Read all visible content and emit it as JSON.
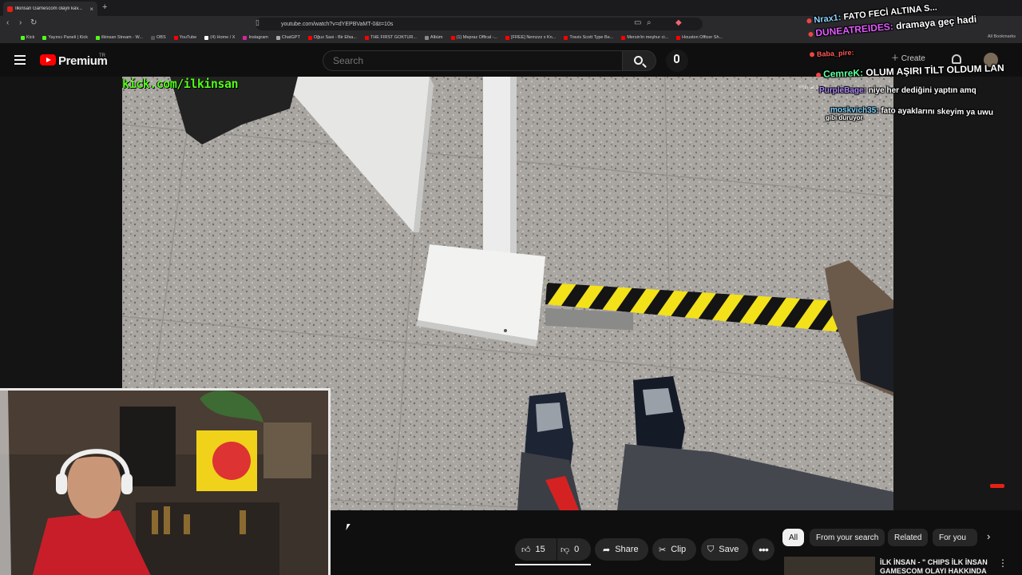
{
  "browser": {
    "tab_title": "İlkinsan Gamescom olaylı kav...",
    "tab_close": "×",
    "new_tab": "+",
    "url": "youtube.com/watch?v=dYEPBVaMT-0&t=10s",
    "bookmarks": [
      "Kick",
      "Yayıncı Paneli | Kick",
      "ilkinsan Stream - W...",
      "OBS",
      "YouTube",
      "(4) Home / X",
      "Instagram",
      "ChatGPT",
      "Oğuz Sasi - Bir Efsa...",
      "THE FIRST GOKTUR...",
      "Albüm",
      "(1) Mepraz Offical -...",
      "[FREE] Nemzzz x Kn...",
      "Travis Scott Type Be...",
      "Mersin'in meşhur ci...",
      "Houston Officer Sh..."
    ],
    "all_bookmarks": "All Bookmarks"
  },
  "youtube": {
    "brand": "Premium",
    "region": "TR",
    "search_placeholder": "Search",
    "create_label": "Create"
  },
  "video": {
    "watermark": "kick.com/ilkinsan",
    "weather": "Köln ☁ 14°C"
  },
  "chat": [
    {
      "user": "Nrax1:",
      "msg": "FATO FECİ ALTINA S..."
    },
    {
      "user": "DUNEATREIDES:",
      "msg": "dramaya geç hadi"
    },
    {
      "user": "Baba_pire:",
      "msg": ""
    },
    {
      "user": "CemreK:",
      "msg": "OLUM AŞIRI TİLT OLDUM LAN"
    },
    {
      "user": "PurpleBage:",
      "msg": "niye her dediğini yaptın amq"
    },
    {
      "user": "moskvich35:",
      "msg": "fato ayaklarını skeyim ya uwu"
    },
    {
      "user": "",
      "msg": "gibi duruyor"
    }
  ],
  "actions": {
    "likes": "15",
    "dislikes": "0",
    "share": "Share",
    "clip": "Clip",
    "save": "Save",
    "more": "•••"
  },
  "chips": [
    "All",
    "From your search",
    "Related",
    "For you"
  ],
  "recommendation": {
    "title": "İLK İNSAN - \" CHIPS İLK İNSAN GAMESCOM OLAYI HAKKINDA",
    "more": "⋮"
  },
  "colors": {
    "kick_green": "#53fc18",
    "youtube_red": "#ff0000",
    "hazard_yellow": "#f3e11a"
  }
}
